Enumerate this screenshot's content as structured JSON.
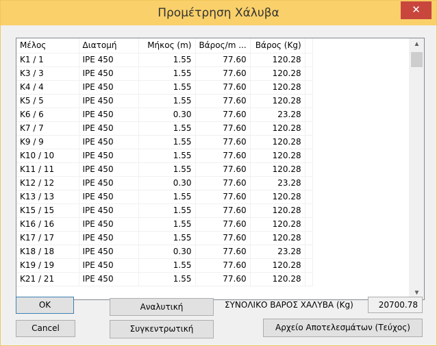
{
  "window": {
    "title": "Προμέτρηση Χάλυβα",
    "close_glyph": "✕"
  },
  "table": {
    "columns": [
      "Μέλος",
      "Διατομή",
      "Μήκος (m)",
      "Βάρος/m ...",
      "Βάρος (Kg)"
    ],
    "rows": [
      [
        "K1 / 1",
        "IPE 450",
        "1.55",
        "77.60",
        "120.28"
      ],
      [
        "K3 / 3",
        "IPE 450",
        "1.55",
        "77.60",
        "120.28"
      ],
      [
        "K4 / 4",
        "IPE 450",
        "1.55",
        "77.60",
        "120.28"
      ],
      [
        "K5 / 5",
        "IPE 450",
        "1.55",
        "77.60",
        "120.28"
      ],
      [
        "K6 / 6",
        "IPE 450",
        "0.30",
        "77.60",
        "23.28"
      ],
      [
        "K7 / 7",
        "IPE 450",
        "1.55",
        "77.60",
        "120.28"
      ],
      [
        "K9 / 9",
        "IPE 450",
        "1.55",
        "77.60",
        "120.28"
      ],
      [
        "K10 / 10",
        "IPE 450",
        "1.55",
        "77.60",
        "120.28"
      ],
      [
        "K11 / 11",
        "IPE 450",
        "1.55",
        "77.60",
        "120.28"
      ],
      [
        "K12 / 12",
        "IPE 450",
        "0.30",
        "77.60",
        "23.28"
      ],
      [
        "K13 / 13",
        "IPE 450",
        "1.55",
        "77.60",
        "120.28"
      ],
      [
        "K15 / 15",
        "IPE 450",
        "1.55",
        "77.60",
        "120.28"
      ],
      [
        "K16 / 16",
        "IPE 450",
        "1.55",
        "77.60",
        "120.28"
      ],
      [
        "K17 / 17",
        "IPE 450",
        "1.55",
        "77.60",
        "120.28"
      ],
      [
        "K18 / 18",
        "IPE 450",
        "0.30",
        "77.60",
        "23.28"
      ],
      [
        "K19 / 19",
        "IPE 450",
        "1.55",
        "77.60",
        "120.28"
      ],
      [
        "K21 / 21",
        "IPE 450",
        "1.55",
        "77.60",
        "120.28"
      ]
    ]
  },
  "scrollbar": {
    "up_glyph": "▲",
    "down_glyph": "▼"
  },
  "buttons": {
    "ok": "OK",
    "cancel": "Cancel",
    "analytic": "Αναλυτική",
    "summary": "Συγκεντρωτική",
    "results_file": "Αρχείο Αποτελεσμάτων (Τεύχος)"
  },
  "total": {
    "label": "ΣΥΝΟΛΙΚΟ ΒΑΡΟΣ ΧΑΛΥΒΑ (Kg)",
    "value": "20700.78"
  }
}
